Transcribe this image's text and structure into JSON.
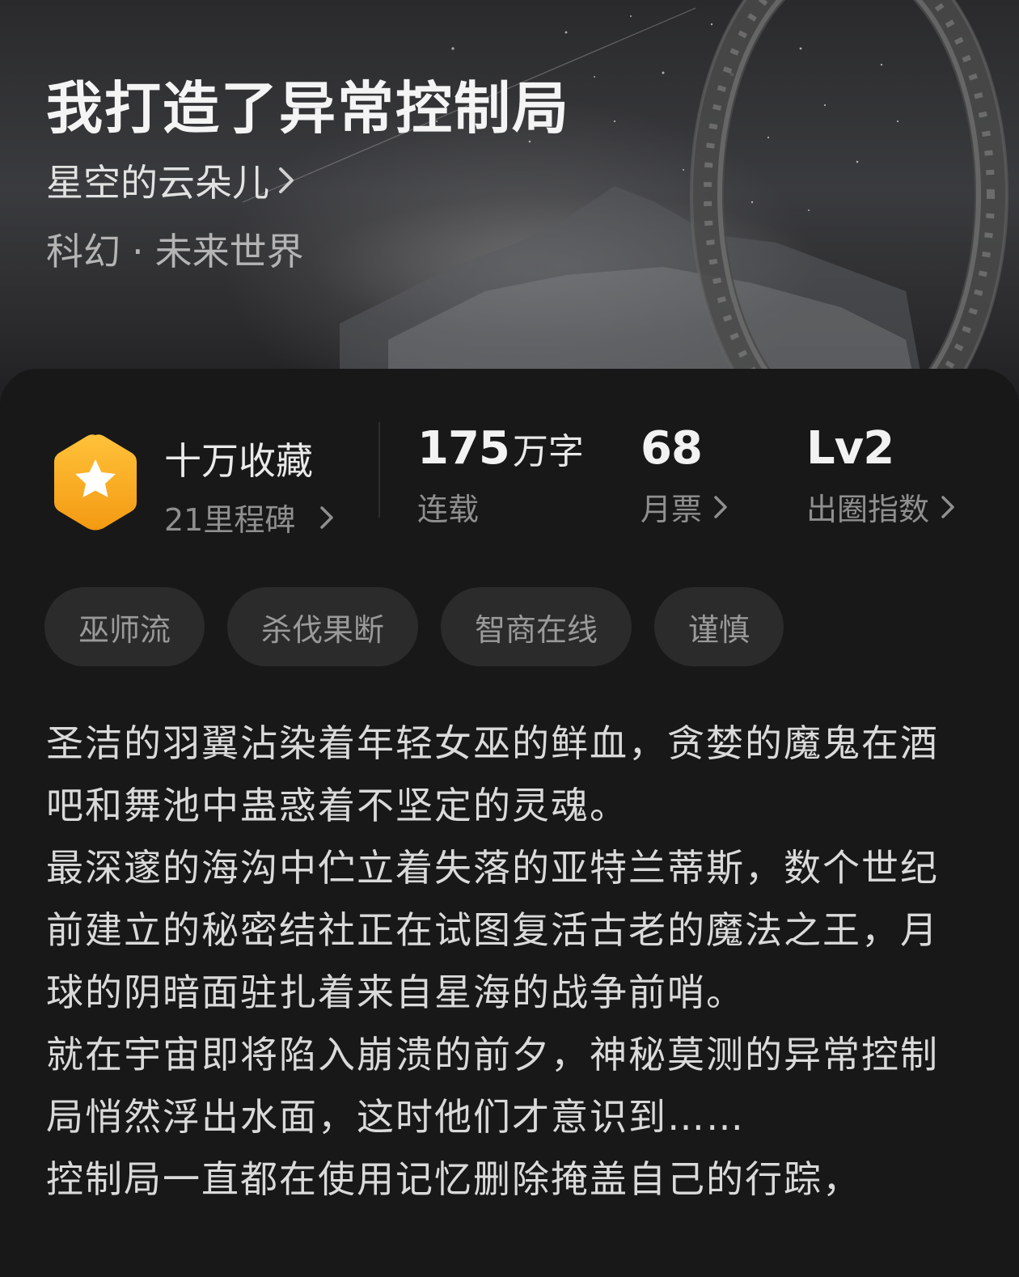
{
  "book": {
    "title": "我打造了异常控制局",
    "author": "星空的云朵儿",
    "genre": "科幻",
    "subgenre": "未来世界",
    "genre_separator": "·"
  },
  "stats": {
    "collection_title": "十万收藏",
    "milestone": "21里程碑",
    "word_count_value": "175",
    "word_count_unit": "万字",
    "status": "连载",
    "monthly_votes": "68",
    "monthly_votes_label": "月票",
    "level": "Lv2",
    "level_label": "出圈指数"
  },
  "tags": [
    "巫师流",
    "杀伐果断",
    "智商在线",
    "谨慎"
  ],
  "synopsis": [
    "圣洁的羽翼沾染着年轻女巫的鲜血，贪婪的魔鬼在酒吧和舞池中蛊惑着不坚定的灵魂。",
    "最深邃的海沟中伫立着失落的亚特兰蒂斯，数个世纪前建立的秘密结社正在试图复活古老的魔法之王，月球的阴暗面驻扎着来自星海的战争前哨。",
    "就在宇宙即将陷入崩溃的前夕，神秘莫测的异常控制局悄然浮出水面，这时他们才意识到……",
    "控制局一直都在使用记忆删除掩盖自己的行踪，"
  ],
  "colors": {
    "background": "#161616",
    "card": "#181818",
    "tag_bg": "#2b2b2b",
    "badge_orange": "#f6a81e"
  },
  "icons": {
    "badge": "hexagon-star-icon",
    "chevron": "chevron-right-icon"
  }
}
